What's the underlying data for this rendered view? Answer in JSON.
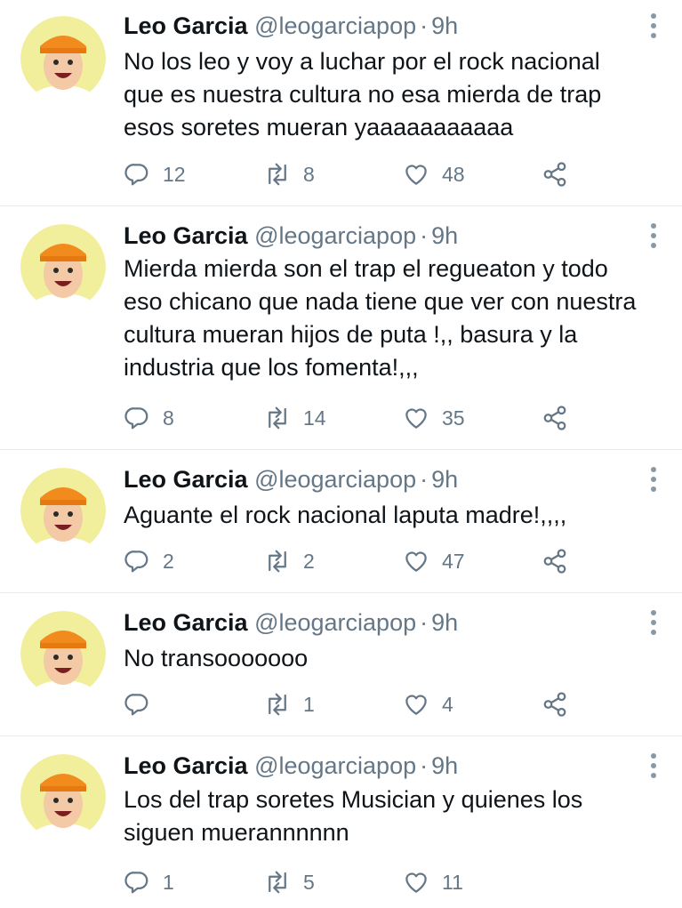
{
  "tweets": [
    {
      "name": "Leo Garcia",
      "handle": "@leogarciapop",
      "separator": "·",
      "time": "9h",
      "lines": [
        "No los leo y voy a luchar por el rock nacional",
        "que es nuestra cultura no esa mierda de trap",
        "esos soretes mueran yaaaaaaaaaaa"
      ],
      "replies": "12",
      "retweets": "8",
      "likes": "48"
    },
    {
      "name": "Leo Garcia",
      "handle": "@leogarciapop",
      "separator": "·",
      "time": "9h",
      "lines": [
        "Mierda mierda son el trap el regueaton y todo",
        "eso chicano que nada tiene que ver con nuestra",
        "cultura mueran hijos de puta !,, basura y la",
        "industria que los fomenta!,,,"
      ],
      "replies": "8",
      "retweets": "14",
      "likes": "35"
    },
    {
      "name": "Leo Garcia",
      "handle": "@leogarciapop",
      "separator": "·",
      "time": "9h",
      "lines": [
        "Aguante el rock nacional laputa madre!,,,,"
      ],
      "replies": "2",
      "retweets": "2",
      "likes": "47"
    },
    {
      "name": "Leo Garcia",
      "handle": "@leogarciapop",
      "separator": "·",
      "time": "9h",
      "lines": [
        "No transooooooo"
      ],
      "replies": "",
      "retweets": "1",
      "likes": "4"
    },
    {
      "name": "Leo Garcia",
      "handle": "@leogarciapop",
      "separator": "·",
      "time": "9h",
      "lines": [
        "Los del trap soretes Musician y quienes los",
        "siguen muerannnnnn"
      ],
      "replies": "1",
      "retweets": "5",
      "likes": "11"
    }
  ],
  "icons": {
    "reply": "reply-icon",
    "retweet": "retweet-icon",
    "like": "heart-icon",
    "share": "share-icon",
    "more": "more-options-icon",
    "avatar": "avatar"
  },
  "colors": {
    "text": "#0f1419",
    "secondary": "#657786",
    "divider": "#e6ecf0",
    "cap": "#f28b1e"
  }
}
